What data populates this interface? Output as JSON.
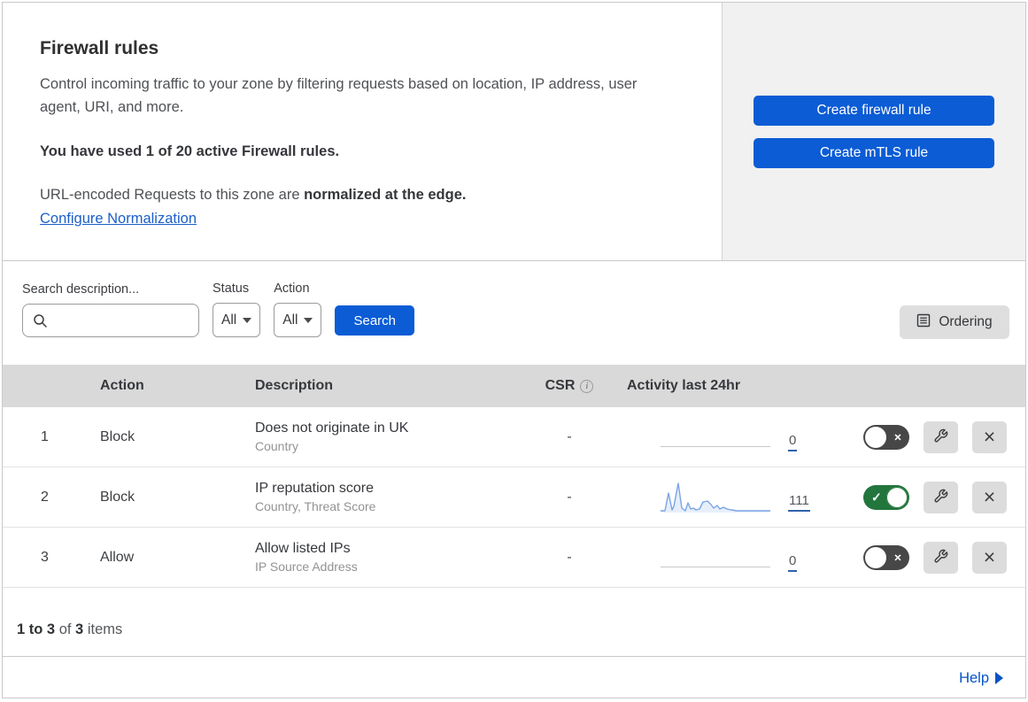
{
  "header": {
    "title": "Firewall rules",
    "description": "Control incoming traffic to your zone by filtering requests based on location, IP address, user agent, URI, and more.",
    "usage_line": "You have used 1 of 20 active Firewall rules.",
    "normalization_prefix": "URL-encoded Requests to this zone are ",
    "normalization_bold": "normalized at the edge.",
    "normalization_link": "Configure Normalization",
    "create_firewall_button": "Create firewall rule",
    "create_mtls_button": "Create mTLS rule"
  },
  "filters": {
    "search_label": "Search description...",
    "search_value": "",
    "status_label": "Status",
    "status_value": "All",
    "action_label": "Action",
    "action_value": "All",
    "search_button": "Search",
    "ordering_button": "Ordering"
  },
  "table": {
    "headers": {
      "action": "Action",
      "description": "Description",
      "csr": "CSR",
      "activity": "Activity last 24hr"
    },
    "rows": [
      {
        "index": "1",
        "action": "Block",
        "title": "Does not originate in UK",
        "subtitle": "Country",
        "csr": "-",
        "activity_count": "0",
        "enabled": false
      },
      {
        "index": "2",
        "action": "Block",
        "title": "IP reputation score",
        "subtitle": "Country, Threat Score",
        "csr": "-",
        "activity_count": "111",
        "enabled": true
      },
      {
        "index": "3",
        "action": "Allow",
        "title": "Allow listed IPs",
        "subtitle": "IP Source Address",
        "csr": "-",
        "activity_count": "0",
        "enabled": false
      }
    ],
    "sparkline_points": [
      [
        0,
        33
      ],
      [
        5,
        33
      ],
      [
        9,
        13
      ],
      [
        13,
        32
      ],
      [
        15,
        28
      ],
      [
        20,
        2
      ],
      [
        24,
        30
      ],
      [
        28,
        33
      ],
      [
        31,
        24
      ],
      [
        34,
        31
      ],
      [
        37,
        30
      ],
      [
        40,
        32
      ],
      [
        44,
        31
      ],
      [
        48,
        23
      ],
      [
        53,
        22
      ],
      [
        57,
        26
      ],
      [
        60,
        30
      ],
      [
        64,
        27
      ],
      [
        67,
        31
      ],
      [
        71,
        29
      ],
      [
        75,
        31
      ],
      [
        80,
        32
      ],
      [
        86,
        33
      ],
      [
        95,
        33
      ],
      [
        110,
        33
      ],
      [
        124,
        33
      ]
    ]
  },
  "footer": {
    "range_bold": "1 to 3",
    "of_text": " of ",
    "total_bold": "3",
    "items_text": " items"
  },
  "help": {
    "label": "Help"
  },
  "colors": {
    "primary_blue": "#0b5cd5",
    "link_blue": "#1b5fc9",
    "toggle_green": "#22753c",
    "toggle_off_gray": "#474747",
    "table_header_gray": "#d9d9d9",
    "panel_gray": "#f1f1f1",
    "sparkline_blue": "#7aa4e6"
  }
}
